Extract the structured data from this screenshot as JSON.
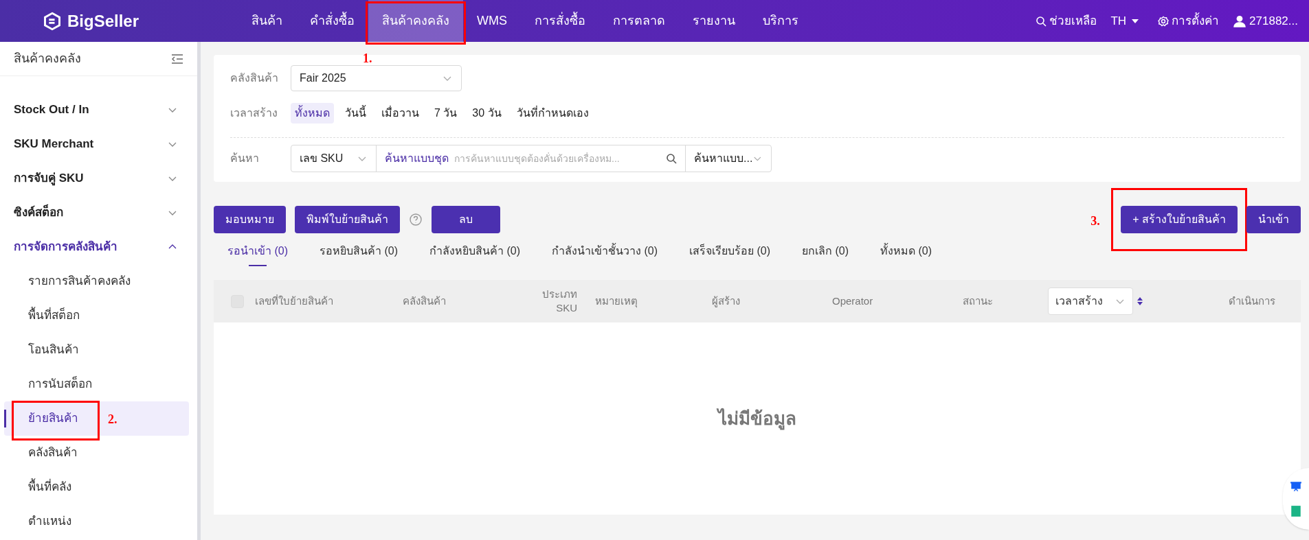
{
  "header": {
    "logo": "BigSeller",
    "nav": [
      {
        "label": "สินค้า",
        "selected": false
      },
      {
        "label": "คำสั่งซื้อ",
        "selected": false
      },
      {
        "label": "สินค้าคงคลัง",
        "selected": true,
        "annotation": "1."
      },
      {
        "label": "WMS",
        "selected": false
      },
      {
        "label": "การสั่งซื้อ",
        "selected": false
      },
      {
        "label": "การตลาด",
        "selected": false
      },
      {
        "label": "รายงาน",
        "selected": false
      },
      {
        "label": "บริการ",
        "selected": false
      }
    ],
    "help": "ช่วยเหลือ",
    "language": "TH",
    "settings": "การตั้งค่า",
    "user": "271882..."
  },
  "sidebar": {
    "title": "สินค้าคงคลัง",
    "items": [
      {
        "label": "Stock Out / In",
        "expanded": false
      },
      {
        "label": "SKU Merchant",
        "expanded": false
      },
      {
        "label": "การจับคู่ SKU",
        "expanded": false
      },
      {
        "label": "ซิงค์สต็อก",
        "expanded": false
      },
      {
        "label": "การจัดการคลังสินค้า",
        "expanded": true,
        "children": [
          {
            "label": "รายการสินค้าคงคลัง",
            "selected": false
          },
          {
            "label": "พื้นที่สต็อก",
            "selected": false
          },
          {
            "label": "โอนสินค้า",
            "selected": false
          },
          {
            "label": "การนับสต็อก",
            "selected": false
          },
          {
            "label": "ย้ายสินค้า",
            "selected": true,
            "annotation": "2."
          },
          {
            "label": "คลังสินค้า",
            "selected": false
          },
          {
            "label": "พื้นที่คลัง",
            "selected": false
          },
          {
            "label": "ตำแหน่ง",
            "selected": false
          }
        ]
      }
    ]
  },
  "filters": {
    "warehouse": {
      "label": "คลังสินค้า",
      "value": "Fair 2025"
    },
    "created_time": {
      "label": "เวลาสร้าง",
      "options": [
        {
          "label": "ทั้งหมด",
          "selected": true
        },
        {
          "label": "วันนี้",
          "selected": false
        },
        {
          "label": "เมื่อวาน",
          "selected": false
        },
        {
          "label": "7 วัน",
          "selected": false
        },
        {
          "label": "30 วัน",
          "selected": false
        },
        {
          "label": "วันที่กำหนดเอง",
          "selected": false
        }
      ]
    },
    "search": {
      "label": "ค้นหา",
      "field_type": "เลข SKU",
      "mode": "ค้นหาแบบชุด",
      "placeholder": "การค้นหาแบบชุดต้องคั่นด้วยเครื่องหม...",
      "scope": "ค้นหาแบบ..."
    }
  },
  "actions": {
    "left": [
      "มอบหมาย",
      "พิมพ์ใบย้ายสินค้า",
      "ลบ"
    ],
    "right": [
      {
        "label": "+ สร้างใบย้ายสินค้า",
        "annotation": "3."
      },
      {
        "label": "นำเข้า"
      }
    ]
  },
  "tabs": [
    {
      "label": "รอนำเข้า (0)",
      "selected": true
    },
    {
      "label": "รอหยิบสินค้า (0)",
      "selected": false
    },
    {
      "label": "กำลังหยิบสินค้า (0)",
      "selected": false
    },
    {
      "label": "กำลังนำเข้าชั้นวาง (0)",
      "selected": false
    },
    {
      "label": "เสร็จเรียบร้อย (0)",
      "selected": false
    },
    {
      "label": "ยกเลิก (0)",
      "selected": false
    },
    {
      "label": "ทั้งหมด (0)",
      "selected": false
    }
  ],
  "table": {
    "select_all_checked": false,
    "columns": [
      "เลขที่ใบย้ายสินค้า",
      "คลังสินค้า",
      "ประเภท SKU",
      "หมายเหตุ",
      "ผู้สร้าง",
      "Operator",
      "สถานะ"
    ],
    "sort_column": "เวลาสร้าง",
    "action_column": "ดำเนินการ",
    "empty": "ไม่มีข้อมูล"
  }
}
